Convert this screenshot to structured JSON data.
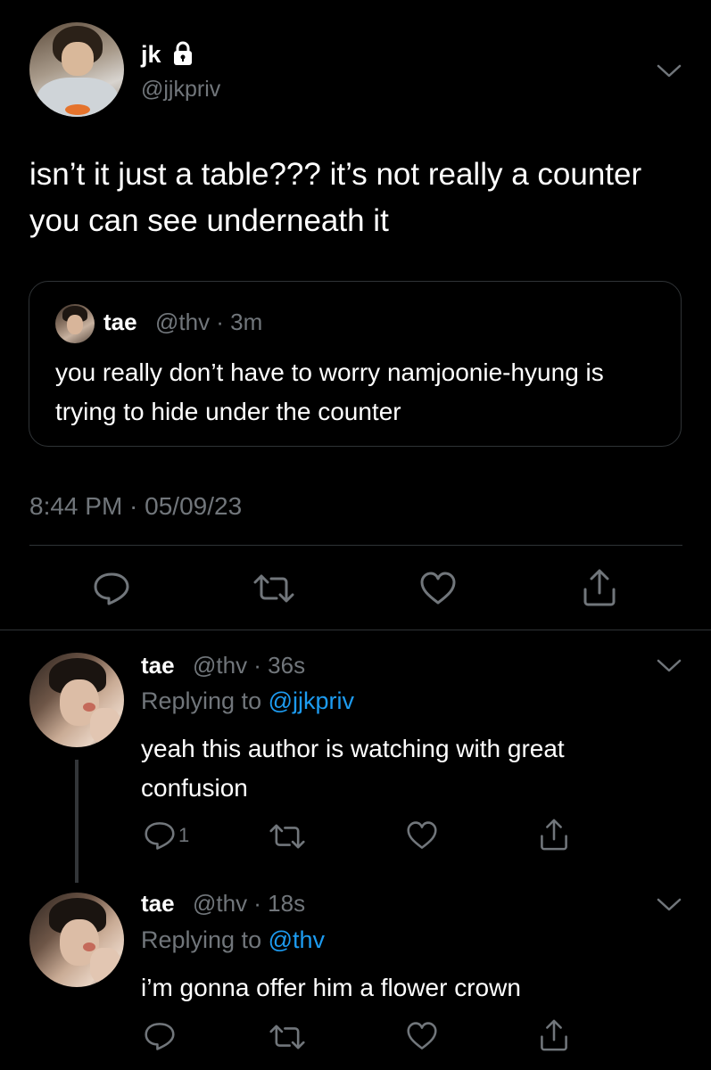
{
  "main_tweet": {
    "display_name": "jk",
    "handle": "@jjkpriv",
    "text": "isn’t it just a table??? it’s not really a counter you can see underneath it",
    "timestamp": "8:44 PM · 05/09/23",
    "quoted": {
      "display_name": "tae",
      "handle_time": "@thv · 3m",
      "text": "you really don’t have to worry namjoonie-hyung is trying to hide under the counter"
    },
    "icons": {
      "lock": "lock-icon",
      "more": "chevron-down-icon",
      "reply": "reply-icon",
      "retweet": "retweet-icon",
      "like": "heart-icon",
      "share": "share-icon"
    }
  },
  "replies": [
    {
      "display_name": "tae",
      "handle_time": "@thv · 36s",
      "replying_prefix": "Replying to",
      "replying_to": "@jjkpriv",
      "text": "yeah this author is watching with great confusion",
      "reply_count": "1"
    },
    {
      "display_name": "tae",
      "handle_time": "@thv · 18s",
      "replying_prefix": "Replying to",
      "replying_to": "@thv",
      "text": "i’m gonna offer him a flower crown"
    }
  ],
  "colors": {
    "background": "#000000",
    "text": "#ffffff",
    "secondary": "#71767b",
    "link": "#1d9bf0",
    "divider": "#2f3336"
  }
}
